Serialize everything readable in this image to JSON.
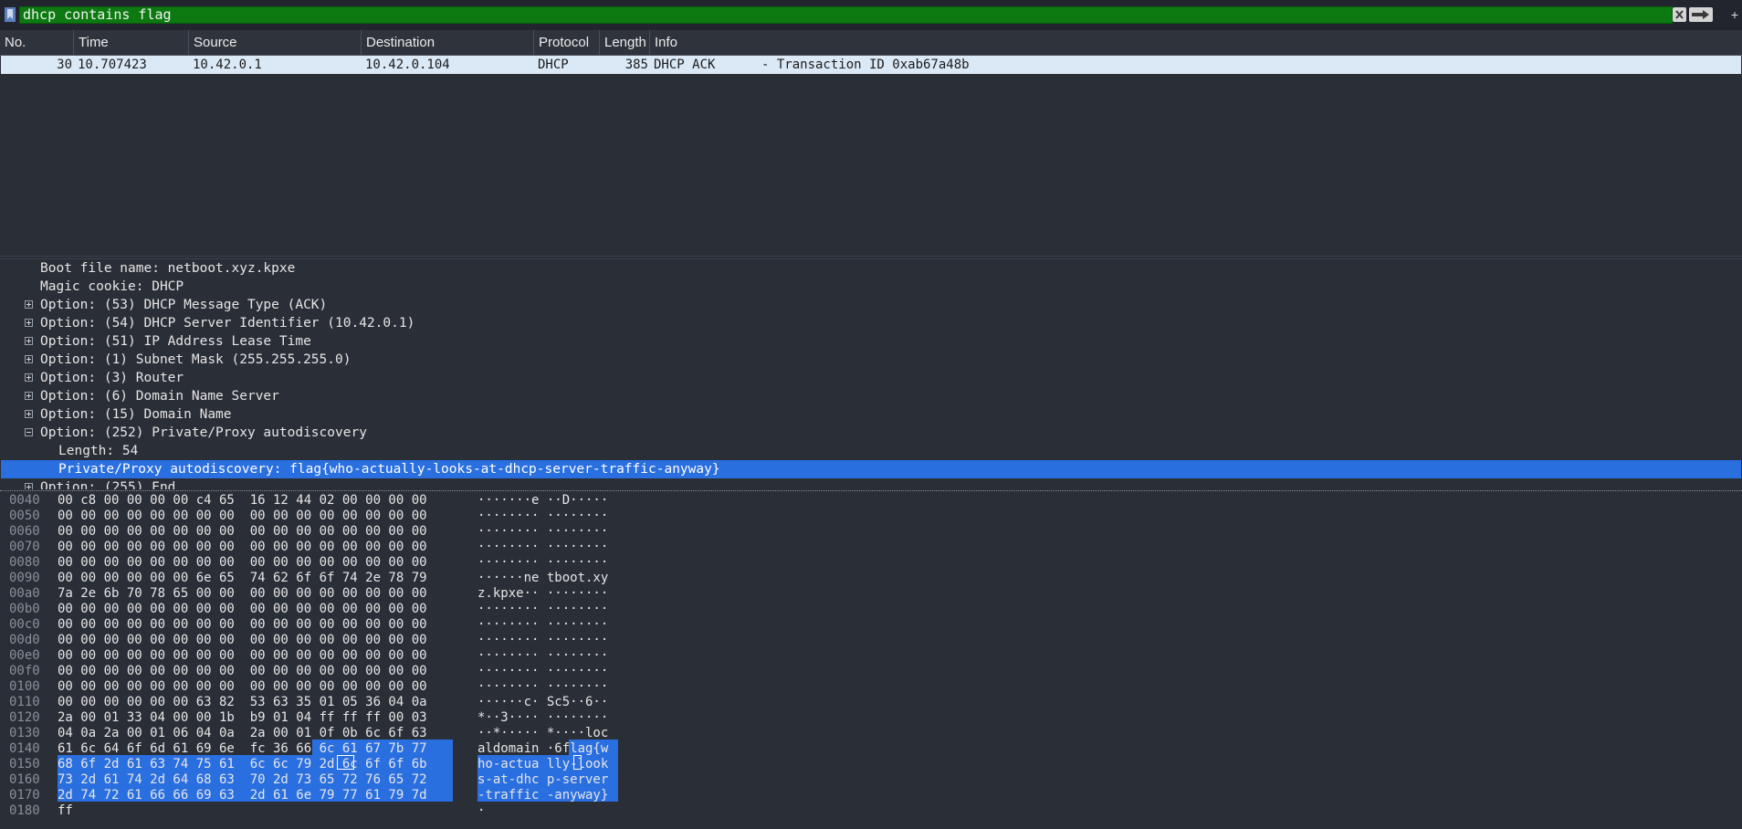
{
  "filter": {
    "value": "dhcp contains flag"
  },
  "packet_list": {
    "columns": [
      "No.",
      "Time",
      "Source",
      "Destination",
      "Protocol",
      "Length",
      "Info"
    ],
    "rows": [
      {
        "no": "30",
        "time": "10.707423",
        "source": "10.42.0.1",
        "destination": "10.42.0.104",
        "protocol": "DHCP",
        "length": "385",
        "info": "DHCP ACK      - Transaction ID 0xab67a48b"
      }
    ]
  },
  "details": [
    {
      "text": "Boot file name: netboot.xyz.kpxe",
      "toggle": "none"
    },
    {
      "text": "Magic cookie: DHCP",
      "toggle": "none"
    },
    {
      "text": "Option: (53) DHCP Message Type (ACK)",
      "toggle": "plus"
    },
    {
      "text": "Option: (54) DHCP Server Identifier (10.42.0.1)",
      "toggle": "plus"
    },
    {
      "text": "Option: (51) IP Address Lease Time",
      "toggle": "plus"
    },
    {
      "text": "Option: (1) Subnet Mask (255.255.255.0)",
      "toggle": "plus"
    },
    {
      "text": "Option: (3) Router",
      "toggle": "plus"
    },
    {
      "text": "Option: (6) Domain Name Server",
      "toggle": "plus"
    },
    {
      "text": "Option: (15) Domain Name",
      "toggle": "plus"
    },
    {
      "text": "Option: (252) Private/Proxy autodiscovery",
      "toggle": "minus"
    },
    {
      "text": "Length: 54",
      "toggle": "child"
    },
    {
      "text": "Private/Proxy autodiscovery: flag{who-actually-looks-at-dhcp-server-traffic-anyway}",
      "toggle": "child-selected"
    },
    {
      "text": "Option: (255) End",
      "toggle": "plus"
    }
  ],
  "hex_dump": [
    {
      "offset": "0040",
      "hex": "00 c8 00 00 00 00 c4 65  16 12 44 02 00 00 00 00",
      "ascii": "·······e ··D·····"
    },
    {
      "offset": "0050",
      "hex": "00 00 00 00 00 00 00 00  00 00 00 00 00 00 00 00",
      "ascii": "········ ········"
    },
    {
      "offset": "0060",
      "hex": "00 00 00 00 00 00 00 00  00 00 00 00 00 00 00 00",
      "ascii": "········ ········"
    },
    {
      "offset": "0070",
      "hex": "00 00 00 00 00 00 00 00  00 00 00 00 00 00 00 00",
      "ascii": "········ ········"
    },
    {
      "offset": "0080",
      "hex": "00 00 00 00 00 00 00 00  00 00 00 00 00 00 00 00",
      "ascii": "········ ········"
    },
    {
      "offset": "0090",
      "hex": "00 00 00 00 00 00 6e 65  74 62 6f 6f 74 2e 78 79",
      "ascii": "······ne tboot.xy"
    },
    {
      "offset": "00a0",
      "hex": "7a 2e 6b 70 78 65 00 00  00 00 00 00 00 00 00 00",
      "ascii": "z.kpxe·· ········"
    },
    {
      "offset": "00b0",
      "hex": "00 00 00 00 00 00 00 00  00 00 00 00 00 00 00 00",
      "ascii": "········ ········"
    },
    {
      "offset": "00c0",
      "hex": "00 00 00 00 00 00 00 00  00 00 00 00 00 00 00 00",
      "ascii": "········ ········"
    },
    {
      "offset": "00d0",
      "hex": "00 00 00 00 00 00 00 00  00 00 00 00 00 00 00 00",
      "ascii": "········ ········"
    },
    {
      "offset": "00e0",
      "hex": "00 00 00 00 00 00 00 00  00 00 00 00 00 00 00 00",
      "ascii": "········ ········"
    },
    {
      "offset": "00f0",
      "hex": "00 00 00 00 00 00 00 00  00 00 00 00 00 00 00 00",
      "ascii": "········ ········"
    },
    {
      "offset": "0100",
      "hex": "00 00 00 00 00 00 00 00  00 00 00 00 00 00 00 00",
      "ascii": "········ ········"
    },
    {
      "offset": "0110",
      "hex": "00 00 00 00 00 00 63 82  53 63 35 01 05 36 04 0a",
      "ascii": "······c· Sc5··6··"
    },
    {
      "offset": "0120",
      "hex": "2a 00 01 33 04 00 00 1b  b9 01 04 ff ff ff 00 03",
      "ascii": "*··3···· ········"
    },
    {
      "offset": "0130",
      "hex": "04 0a 2a 00 01 06 04 0a  2a 00 01 0f 0b 6c 6f 63",
      "ascii": "··*····· *····loc"
    },
    {
      "offset": "0140",
      "hex": "61 6c 64 6f 6d 61 69 6e  fc 36 66 6c 61 67 7b 77",
      "ascii": "aldomain ·6flag{w"
    },
    {
      "offset": "0150",
      "hex": "68 6f 2d 61 63 74 75 61  6c 6c 79 2d 6c 6f 6f 6b",
      "ascii": "ho-actua lly-look"
    },
    {
      "offset": "0160",
      "hex": "73 2d 61 74 2d 64 68 63  70 2d 73 65 72 76 65 72",
      "ascii": "s-at-dhc p-server"
    },
    {
      "offset": "0170",
      "hex": "2d 74 72 61 66 66 69 63  2d 61 6e 79 77 61 79 7d",
      "ascii": "-traffic -anyway}"
    },
    {
      "offset": "0180",
      "hex": "ff",
      "ascii": "·"
    }
  ],
  "colors": {
    "filter_valid": "#0c7a10",
    "selection": "#2a6fe0",
    "row_selected": "#dbe9f7"
  },
  "icons": {
    "bookmark": "bookmark-icon",
    "clear": "clear-filter-icon",
    "apply": "apply-arrow-icon",
    "expand": "plus-icon"
  }
}
